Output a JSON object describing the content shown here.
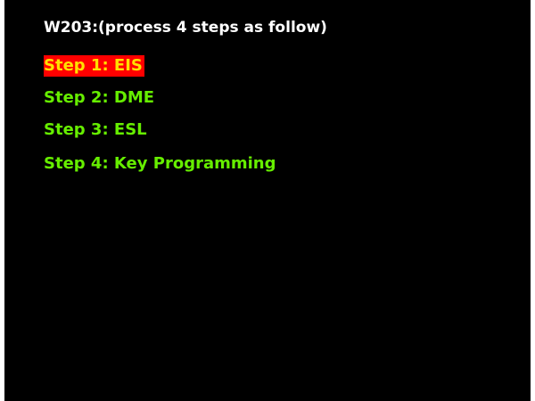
{
  "screen": {
    "title": "W203:(process 4 steps as follow)",
    "steps": [
      {
        "label": "Step 1: EIS",
        "selected": true
      },
      {
        "label": "Step 2: DME",
        "selected": false
      },
      {
        "label": "Step 3: ESL",
        "selected": false
      },
      {
        "label": "Step 4: Key Programming",
        "selected": false
      }
    ]
  },
  "colors": {
    "background": "#000000",
    "title": "#ffffff",
    "step_text": "#66ee00",
    "selected_text": "#ffe000",
    "selected_highlight": "#ff0000"
  }
}
